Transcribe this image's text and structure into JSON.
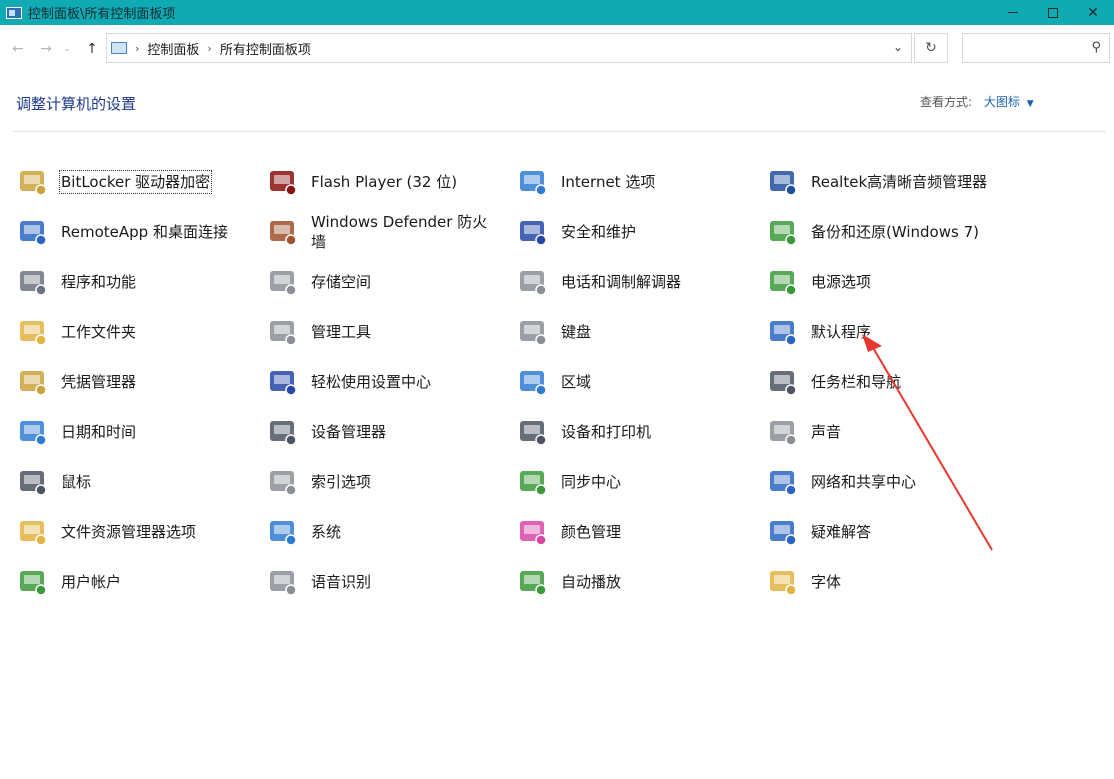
{
  "window": {
    "title": "控制面板\\所有控制面板项"
  },
  "address": {
    "crumbs": [
      "控制面板",
      "所有控制面板项"
    ],
    "search_placeholder": ""
  },
  "header": {
    "heading": "调整计算机的设置",
    "view_by_label": "查看方式:",
    "view_by_value": "大图标"
  },
  "items": [
    {
      "label": "BitLocker 驱动器加密",
      "icon": "bitlocker-key-icon",
      "color": "#c9a23a"
    },
    {
      "label": "Flash Player (32 位)",
      "icon": "flash-player-icon",
      "color": "#8b1111"
    },
    {
      "label": "Internet 选项",
      "icon": "internet-globe-icon",
      "color": "#2e7bd1"
    },
    {
      "label": "Realtek高清晰音频管理器",
      "icon": "realtek-audio-icon",
      "color": "#1f4fa0"
    },
    {
      "label": "RemoteApp 和桌面连接",
      "icon": "remoteapp-icon",
      "color": "#2a66c2"
    },
    {
      "label": "Windows Defender 防火墙",
      "icon": "firewall-icon",
      "color": "#a0512d"
    },
    {
      "label": "安全和维护",
      "icon": "security-flag-icon",
      "color": "#2447a8"
    },
    {
      "label": "备份和还原(Windows 7)",
      "icon": "backup-icon",
      "color": "#3a9a3a"
    },
    {
      "label": "程序和功能",
      "icon": "programs-icon",
      "color": "#6b7280"
    },
    {
      "label": "存储空间",
      "icon": "storage-icon",
      "color": "#8a8f96"
    },
    {
      "label": "电话和调制解调器",
      "icon": "phone-modem-icon",
      "color": "#8a8f96"
    },
    {
      "label": "电源选项",
      "icon": "power-battery-icon",
      "color": "#3a9a3a"
    },
    {
      "label": "工作文件夹",
      "icon": "work-folders-icon",
      "color": "#e3b341"
    },
    {
      "label": "管理工具",
      "icon": "admin-tools-icon",
      "color": "#8a8f96"
    },
    {
      "label": "键盘",
      "icon": "keyboard-icon",
      "color": "#8a8f96"
    },
    {
      "label": "默认程序",
      "icon": "default-programs-icon",
      "color": "#2a66c2"
    },
    {
      "label": "凭据管理器",
      "icon": "credential-icon",
      "color": "#c9a23a"
    },
    {
      "label": "轻松使用设置中心",
      "icon": "ease-of-access-icon",
      "color": "#2447a8"
    },
    {
      "label": "区域",
      "icon": "region-globe-icon",
      "color": "#2e7bd1"
    },
    {
      "label": "任务栏和导航",
      "icon": "taskbar-icon",
      "color": "#4b5563"
    },
    {
      "label": "日期和时间",
      "icon": "date-time-icon",
      "color": "#2e7bd1"
    },
    {
      "label": "设备管理器",
      "icon": "device-manager-icon",
      "color": "#4b5563"
    },
    {
      "label": "设备和打印机",
      "icon": "printer-icon",
      "color": "#4b5563"
    },
    {
      "label": "声音",
      "icon": "speaker-icon",
      "color": "#8a8f96"
    },
    {
      "label": "鼠标",
      "icon": "mouse-icon",
      "color": "#4b5563"
    },
    {
      "label": "索引选项",
      "icon": "indexing-icon",
      "color": "#8a8f96"
    },
    {
      "label": "同步中心",
      "icon": "sync-center-icon",
      "color": "#3a9a3a"
    },
    {
      "label": "网络和共享中心",
      "icon": "network-sharing-icon",
      "color": "#2a66c2"
    },
    {
      "label": "文件资源管理器选项",
      "icon": "explorer-options-icon",
      "color": "#e3b341"
    },
    {
      "label": "系统",
      "icon": "system-monitor-icon",
      "color": "#2e7bd1"
    },
    {
      "label": "颜色管理",
      "icon": "color-management-icon",
      "color": "#d946a8"
    },
    {
      "label": "疑难解答",
      "icon": "troubleshooting-icon",
      "color": "#2a66c2"
    },
    {
      "label": "用户帐户",
      "icon": "user-accounts-icon",
      "color": "#3a9a3a"
    },
    {
      "label": "语音识别",
      "icon": "microphone-icon",
      "color": "#8a8f96"
    },
    {
      "label": "自动播放",
      "icon": "autoplay-icon",
      "color": "#3a9a3a"
    },
    {
      "label": "字体",
      "icon": "fonts-icon",
      "color": "#e3b341"
    }
  ]
}
